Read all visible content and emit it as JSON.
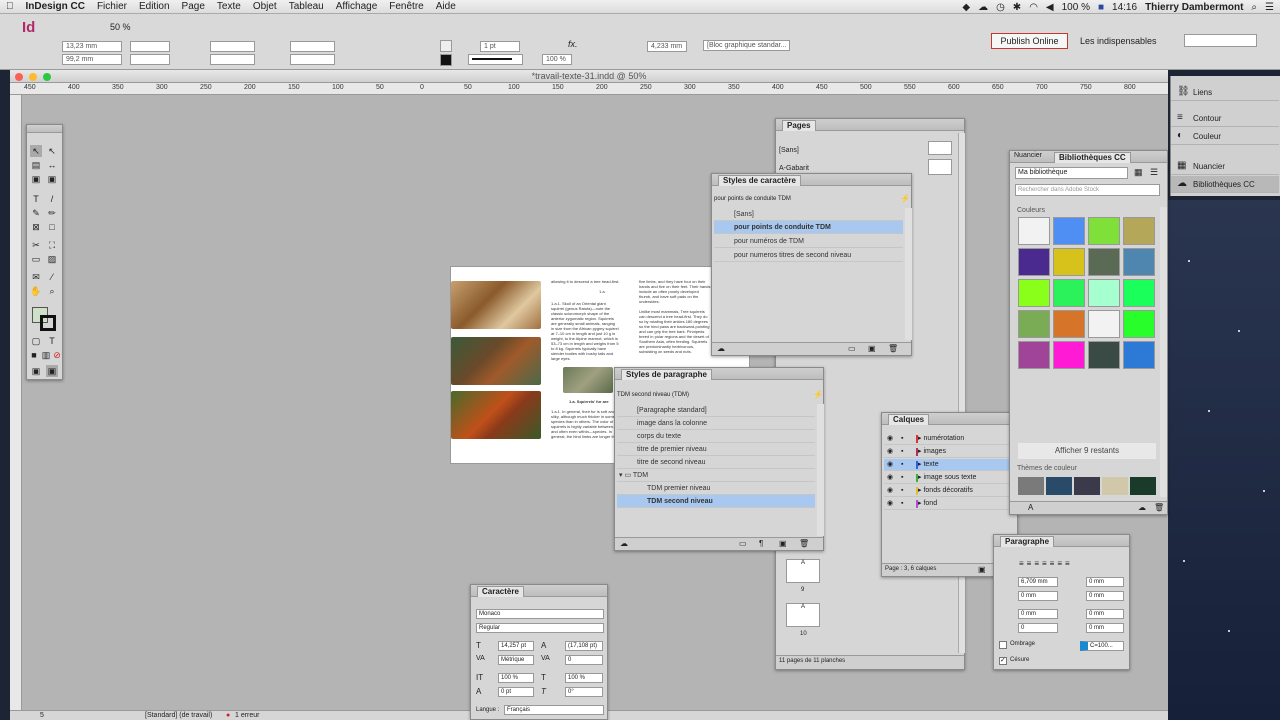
{
  "menubar": {
    "apple": "",
    "app_name": "InDesign CC",
    "items": [
      "Fichier",
      "Edition",
      "Page",
      "Texte",
      "Objet",
      "Tableau",
      "Affichage",
      "Fenêtre",
      "Aide"
    ],
    "battery": "100 %",
    "time": "14:16",
    "user": "Thierry Dambermont"
  },
  "control": {
    "app_logo": "Id",
    "zoom": "50 %",
    "x": "13,23 mm",
    "y": "99,2 mm",
    "stroke_weight": "1 pt",
    "opacity": "100 %",
    "width_val": "4,233 mm",
    "object_style": "[Bloc graphique standar...",
    "publish": "Publish Online",
    "workspace": "Les indispensables",
    "help_placeholder": ""
  },
  "document": {
    "title": "*travail-texte-31.indd @ 50%",
    "ruler_h": [
      "450",
      "400",
      "350",
      "300",
      "250",
      "200",
      "150",
      "100",
      "50",
      "0",
      "50",
      "100",
      "150",
      "200",
      "250",
      "300",
      "350",
      "400",
      "450",
      "500",
      "550",
      "600",
      "650",
      "700",
      "750",
      "800"
    ],
    "status": {
      "page": "5",
      "style": "[Standard] (de travail)",
      "errors": "1 erreur"
    },
    "spread": {
      "col1_intro": "allowing it to descend a tree head-first.",
      "figure_label": "1.a.",
      "col1_text": "1.a.1. Skull of an Oriental giant squirrel (genus Ratufa)—note the classic sciuromorph shape of the anterior zygomatic region. Squirrels are generally small animals, ranging in size from the African pygmy squirrel at 7–10 cm in length and just 10 g in weight, to the Alpine marmot, which is 53–73 cm in length and weighs from 5 to 8 kg. Squirrels typically have slender bodies with bushy tails and large eyes.",
      "col2_intro": "five limbs, and they have four on their hands and five on their feet. Their hands include an often poorly developed thumb, and have soft pads on the undersides.",
      "col2_text": "Unlike most mammals, Tree squirrels can descend a tree head-first. They do so by rotating their ankles 180 degrees so the hind paws are backward-pointing and can grip the tree bark. Pinnipeds breed in polar regions and the desert of Southern Asia, often feeding. Squirrels are predominantly herbivorous, subsisting on seeds and nuts.",
      "col2_heading": "1.a. Squirrels' fur are",
      "col2_body": "1.a.1. In general, their fur is soft and silky, although much thicker in some species than in others. The color of squirrels is highly variable between—and often even within—species. In general, the hind limbs are longer than the fore limbs."
    }
  },
  "pages_panel": {
    "title": "Pages",
    "none": "[Sans]",
    "master": "A-Gabarit",
    "footer": "11 pages de 11 planches",
    "page_numbers": [
      "9",
      "10"
    ],
    "master_letter": "A"
  },
  "char_styles": {
    "title": "Styles de caractère",
    "current": "pour points de conduite TDM",
    "items": [
      "[Sans]",
      "pour points de conduite TDM",
      "pour numéros de TDM",
      "pour numeros titres de second niveau"
    ]
  },
  "para_styles": {
    "title": "Styles de paragraphe",
    "current": "TDM second niveau (TDM)",
    "items": [
      "[Paragraphe standard]",
      "image dans la colonne",
      "corps du texte",
      "titre de premier niveau",
      "titre de second niveau"
    ],
    "group": "TDM",
    "group_items": [
      "TDM premier niveau",
      "TDM second niveau"
    ]
  },
  "layers": {
    "title": "Calques",
    "items": [
      {
        "name": "numérotation",
        "color": "#e03030"
      },
      {
        "name": "images",
        "color": "#b03060"
      },
      {
        "name": "texte",
        "color": "#3060e0"
      },
      {
        "name": "image sous texte",
        "color": "#3bb03b"
      },
      {
        "name": "fonds décoratifs",
        "color": "#e0c030"
      },
      {
        "name": "fond",
        "color": "#b050d0"
      }
    ],
    "footer": "Page : 3, 6 calques"
  },
  "libraries": {
    "tab1": "Nuancier",
    "tab2": "Bibliothèques CC",
    "library": "Ma bibliothèque",
    "search_placeholder": "Rechercher dans Adobe Stock",
    "colors_label": "Couleurs",
    "swatches": [
      "#f2f2f2",
      "#4f8ef2",
      "#7fe03a",
      "#b5a75a",
      "#4a2a8f",
      "#d6c21a",
      "#5a6a55",
      "#4f86b0",
      "#8aff1a",
      "#2bf25a",
      "#a6ffcf",
      "#1aff5a",
      "#7aab55",
      "#d6752a",
      "#f2f2f2",
      "#28ff2a",
      "#a0449a",
      "#ff1ad6",
      "#3a4a44",
      "#2d7ad6"
    ],
    "show_more": "Afficher 9 restants",
    "themes_label": "Thèmes de couleur",
    "themes": [
      "#7a7a7a",
      "#2a4a6a",
      "#3a3a4a",
      "#d0c8a8",
      "#1a3a2a"
    ]
  },
  "dock": {
    "items": [
      {
        "label": "Liens",
        "icon": "⛓"
      },
      {
        "label": "Contour",
        "icon": "≡"
      },
      {
        "label": "Couleur",
        "icon": "◐"
      },
      {
        "label": "Nuancier",
        "icon": "▦"
      },
      {
        "label": "Bibliothèques CC",
        "icon": "☁"
      }
    ]
  },
  "character": {
    "title": "Caractère",
    "font": "Monaco",
    "style": "Regular",
    "size": "14,257 pt",
    "leading": "(17,108 pt)",
    "kerning": "Métrique",
    "tracking": "0",
    "vscale": "100 %",
    "hscale": "100 %",
    "baseline": "0 pt",
    "skew": "0°",
    "language_label": "Langue :",
    "language": "Français"
  },
  "paragraph": {
    "title": "Paragraphe",
    "left_indent": "6,709 mm",
    "right_indent": "0 mm",
    "first_line": "0 mm",
    "last_line": "0 mm",
    "space_before": "0 mm",
    "space_after": "0 mm",
    "drop_cap_lines": "0",
    "drop_cap_chars": "0 mm",
    "shading_label": "Ombrage",
    "shading_color": "C=100...",
    "hyphenation_label": "Césure"
  }
}
